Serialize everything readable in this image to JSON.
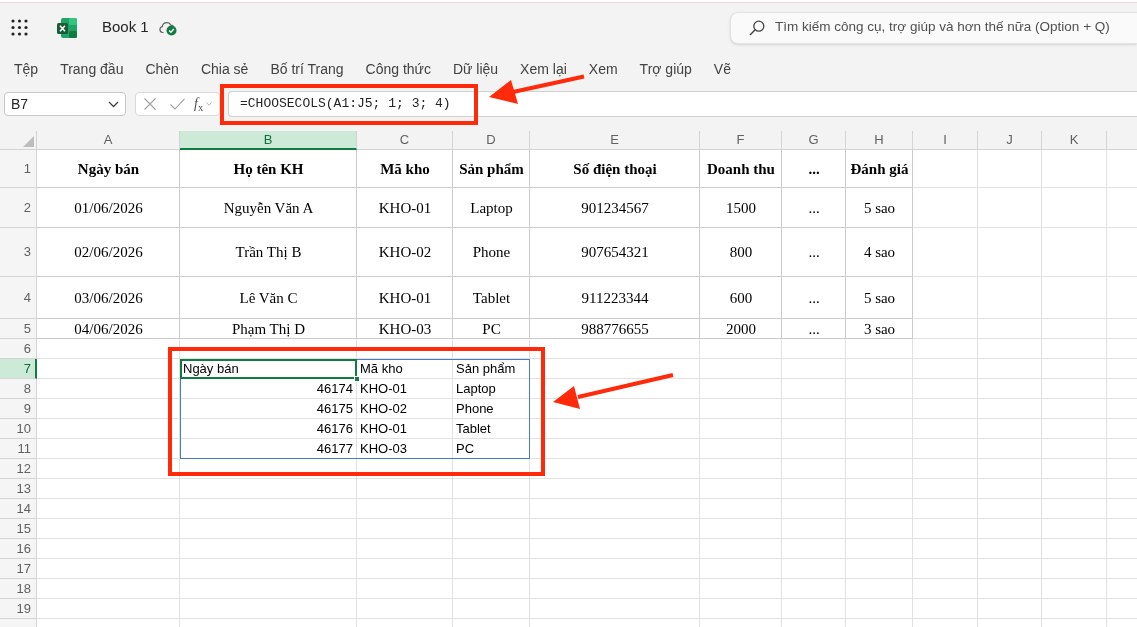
{
  "title_bar": {
    "title": "Book 1",
    "search": {
      "placeholder": "Tìm kiếm công cụ, trợ giúp và hơn thế nữa (Option + Q)"
    }
  },
  "ribbon_tabs": [
    {
      "label": "Tệp",
      "selected": false
    },
    {
      "label": "Trang đầu",
      "selected": false
    },
    {
      "label": "Chèn",
      "selected": false
    },
    {
      "label": "Chia sẻ",
      "selected": false
    },
    {
      "label": "Bố trí Trang",
      "selected": false
    },
    {
      "label": "Công thức",
      "selected": false
    },
    {
      "label": "Dữ liệu",
      "selected": false
    },
    {
      "label": "Xem lại",
      "selected": false
    },
    {
      "label": "Xem",
      "selected": false
    },
    {
      "label": "Trợ giúp",
      "selected": false
    },
    {
      "label": "Vẽ",
      "selected": false
    }
  ],
  "formula_bar": {
    "name_box": "B7",
    "function_label": "*f*$_{x}$",
    "formula": "=CHOOSECOLS(A1:J5; 1; 3; 4)"
  },
  "sheet": {
    "columns": [
      {
        "label": "A",
        "selected": false
      },
      {
        "label": "B",
        "selected": true
      },
      {
        "label": "C",
        "selected": false
      },
      {
        "label": "D",
        "selected": false
      },
      {
        "label": "E",
        "selected": false
      },
      {
        "label": "F",
        "selected": false
      },
      {
        "label": "G",
        "selected": false
      },
      {
        "label": "H",
        "selected": false
      },
      {
        "label": "I",
        "selected": false
      },
      {
        "label": "J",
        "selected": false
      },
      {
        "label": "K",
        "selected": false
      }
    ],
    "rows": [
      {
        "label": "1",
        "selected": false,
        "kind": "header",
        "cells": [
          {
            "text": "Ngày bán",
            "selected": false
          },
          {
            "text": "Họ tên KH",
            "selected": false
          },
          {
            "text": "Mã kho",
            "selected": false
          },
          {
            "text": "Sản phẩm",
            "selected": false
          },
          {
            "text": "Số điện thoại",
            "selected": false
          },
          {
            "text": "Doanh thu",
            "selected": false
          },
          {
            "text": "...",
            "selected": false
          },
          {
            "text": "Đánh giá",
            "selected": false
          }
        ]
      },
      {
        "label": "2",
        "selected": false,
        "kind": "data",
        "cells": [
          {
            "text": "01/06/2026",
            "selected": false
          },
          {
            "text": "Nguyễn Văn A",
            "selected": false
          },
          {
            "text": "KHO-01",
            "selected": false
          },
          {
            "text": "Laptop",
            "selected": false
          },
          {
            "text": "901234567",
            "selected": false
          },
          {
            "text": "1500",
            "selected": false
          },
          {
            "text": "...",
            "selected": false
          },
          {
            "text": "5 sao",
            "selected": false
          }
        ]
      },
      {
        "label": "3",
        "selected": false,
        "kind": "data",
        "cells": [
          {
            "text": "02/06/2026",
            "selected": false
          },
          {
            "text": "Trần Thị B",
            "selected": false
          },
          {
            "text": "KHO-02",
            "selected": false
          },
          {
            "text": "Phone",
            "selected": false
          },
          {
            "text": "907654321",
            "selected": false
          },
          {
            "text": "800",
            "selected": false
          },
          {
            "text": "...",
            "selected": false
          },
          {
            "text": "4 sao",
            "selected": false
          }
        ]
      },
      {
        "label": "4",
        "selected": false,
        "kind": "data",
        "cells": [
          {
            "text": "03/06/2026",
            "selected": false
          },
          {
            "text": "Lê Văn C",
            "selected": false
          },
          {
            "text": "KHO-01",
            "selected": false
          },
          {
            "text": "Tablet",
            "selected": false
          },
          {
            "text": "911223344",
            "selected": false
          },
          {
            "text": "600",
            "selected": false
          },
          {
            "text": "...",
            "selected": false
          },
          {
            "text": "5 sao",
            "selected": false
          }
        ]
      },
      {
        "label": "5",
        "selected": false,
        "kind": "data",
        "cells": [
          {
            "text": "04/06/2026",
            "selected": false
          },
          {
            "text": "Phạm Thị D",
            "selected": false
          },
          {
            "text": "KHO-03",
            "selected": false
          },
          {
            "text": "PC",
            "selected": false
          },
          {
            "text": "988776655",
            "selected": false
          },
          {
            "text": "2000",
            "selected": false
          },
          {
            "text": "...",
            "selected": false
          },
          {
            "text": "3 sao",
            "selected": false
          }
        ]
      },
      {
        "label": "6",
        "selected": false,
        "kind": "empty"
      },
      {
        "label": "7",
        "selected": true,
        "kind": "result",
        "cells": [
          {
            "text": "Ngày bán",
            "kind": "text",
            "selected": true
          },
          {
            "text": "Mã kho",
            "kind": "text",
            "selected": false
          },
          {
            "text": "Sản phẩm",
            "kind": "text",
            "selected": false
          }
        ]
      },
      {
        "label": "8",
        "selected": false,
        "kind": "result",
        "cells": [
          {
            "text": "46174",
            "kind": "number",
            "selected": false
          },
          {
            "text": "KHO-01",
            "kind": "text",
            "selected": false
          },
          {
            "text": "Laptop",
            "kind": "text",
            "selected": false
          }
        ]
      },
      {
        "label": "9",
        "selected": false,
        "kind": "result",
        "cells": [
          {
            "text": "46175",
            "kind": "number",
            "selected": false
          },
          {
            "text": "KHO-02",
            "kind": "text",
            "selected": false
          },
          {
            "text": "Phone",
            "kind": "text",
            "selected": false
          }
        ]
      },
      {
        "label": "10",
        "selected": false,
        "kind": "result",
        "cells": [
          {
            "text": "46176",
            "kind": "number",
            "selected": false
          },
          {
            "text": "KHO-01",
            "kind": "text",
            "selected": false
          },
          {
            "text": "Tablet",
            "kind": "text",
            "selected": false
          }
        ]
      },
      {
        "label": "11",
        "selected": false,
        "kind": "result",
        "cells": [
          {
            "text": "46177",
            "kind": "number",
            "selected": false
          },
          {
            "text": "KHO-03",
            "kind": "text",
            "selected": false
          },
          {
            "text": "PC",
            "kind": "text",
            "selected": false
          }
        ]
      },
      {
        "label": "12",
        "selected": false,
        "kind": "empty"
      },
      {
        "label": "13",
        "selected": false,
        "kind": "empty"
      },
      {
        "label": "14",
        "selected": false,
        "kind": "empty"
      },
      {
        "label": "15",
        "selected": false,
        "kind": "empty"
      },
      {
        "label": "16",
        "selected": false,
        "kind": "empty"
      },
      {
        "label": "17",
        "selected": false,
        "kind": "empty"
      },
      {
        "label": "18",
        "selected": false,
        "kind": "empty"
      },
      {
        "label": "19",
        "selected": false,
        "kind": "empty"
      }
    ]
  }
}
